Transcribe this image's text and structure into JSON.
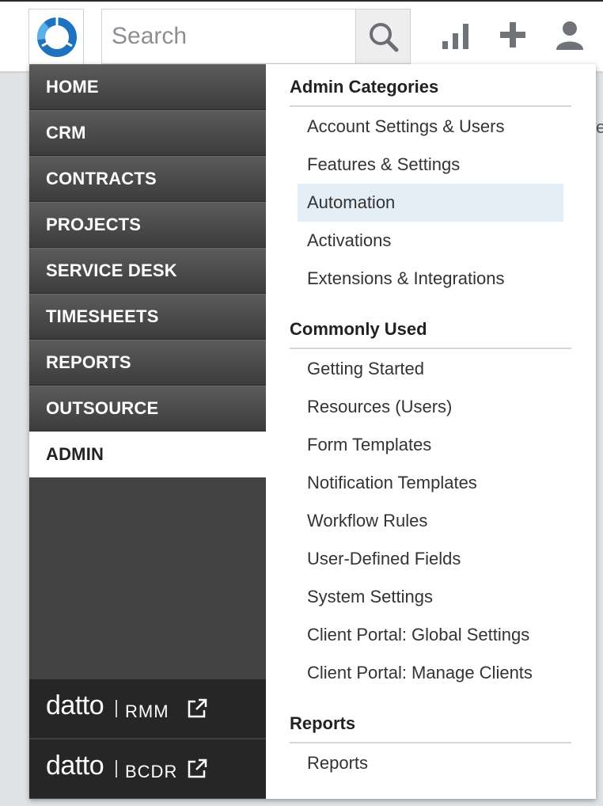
{
  "search": {
    "placeholder": "Search"
  },
  "top_icons": [
    "logo-icon",
    "search-icon",
    "bar-chart-icon",
    "plus-icon",
    "user-icon"
  ],
  "nav": {
    "items": [
      {
        "label": "HOME",
        "active": false
      },
      {
        "label": "CRM",
        "active": false
      },
      {
        "label": "CONTRACTS",
        "active": false
      },
      {
        "label": "PROJECTS",
        "active": false
      },
      {
        "label": "SERVICE DESK",
        "active": false
      },
      {
        "label": "TIMESHEETS",
        "active": false
      },
      {
        "label": "REPORTS",
        "active": false
      },
      {
        "label": "OUTSOURCE",
        "active": false
      },
      {
        "label": "ADMIN",
        "active": true
      }
    ],
    "external": [
      {
        "brand": "datto",
        "product": "RMM"
      },
      {
        "brand": "datto",
        "product": "BCDR"
      }
    ]
  },
  "admin": {
    "sections": [
      {
        "title": "Admin Categories",
        "links": [
          "Account Settings & Users",
          "Features & Settings",
          "Automation",
          "Activations",
          "Extensions & Integrations"
        ]
      },
      {
        "title": "Commonly Used",
        "links": [
          "Getting Started",
          "Resources (Users)",
          "Form Templates",
          "Notification Templates",
          "Workflow Rules",
          "User-Defined Fields",
          "System Settings",
          "Client Portal: Global Settings",
          "Client Portal: Manage Clients"
        ]
      },
      {
        "title": "Reports",
        "links": [
          "Reports"
        ]
      }
    ],
    "highlighted_link": "Automation"
  },
  "colors": {
    "nav_bg": "#424242",
    "nav_active_bg": "#ffffff",
    "highlight_bg": "#e6eef5",
    "logo_blue": "#1e73be"
  }
}
